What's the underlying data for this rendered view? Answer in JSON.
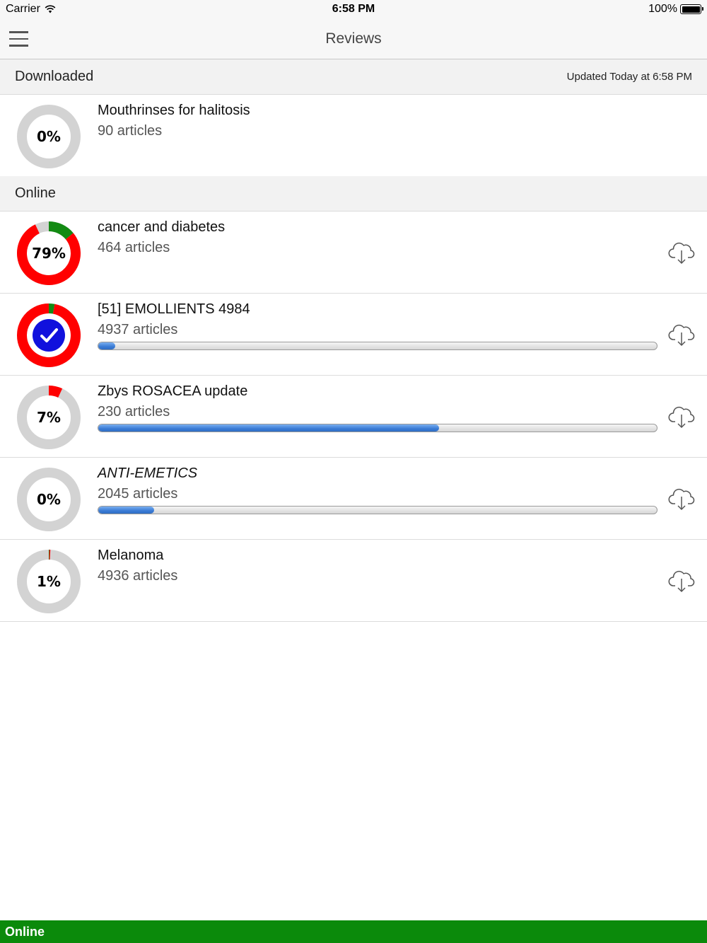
{
  "status_bar": {
    "carrier": "Carrier",
    "time": "6:58 PM",
    "battery": "100%"
  },
  "nav": {
    "title": "Reviews",
    "menu_icon": "hamburger-menu-icon"
  },
  "downloaded": {
    "title": "Downloaded",
    "updated": "Updated Today at 6:58 PM",
    "items": [
      {
        "title": "Mouthrinses for halitosis",
        "subtitle": "90 articles",
        "percent": "0%",
        "ring": {
          "red": 0,
          "green": 0
        }
      }
    ]
  },
  "online": {
    "title": "Online",
    "items": [
      {
        "title": "cancer and diabetes",
        "subtitle": "464 articles",
        "percent": "79%",
        "ring": {
          "red": 0.79,
          "green": 0.14
        },
        "progress": null,
        "icon": "cloud-download-icon"
      },
      {
        "title": "[51] EMOLLIENTS 4984",
        "subtitle": "4937 articles",
        "percent": "",
        "ring": {
          "red": 0.97,
          "green": 0.03
        },
        "checked": true,
        "progress": 0.03,
        "icon": "cloud-download-icon"
      },
      {
        "title": "Zbys ROSACEA update",
        "subtitle": "230 articles",
        "percent": "7%",
        "ring": {
          "red": 0.07,
          "green": 0
        },
        "progress": 0.61,
        "icon": "cloud-download-icon"
      },
      {
        "title": "ANTI-EMETICS",
        "subtitle": "2045 articles",
        "percent": "0%",
        "ring": {
          "red": 0,
          "green": 0
        },
        "progress": 0.1,
        "italic": true,
        "icon": "cloud-download-icon"
      },
      {
        "title": "Melanoma",
        "subtitle": "4936 articles",
        "percent": "1%",
        "ring": {
          "red": 0.005,
          "green": 0.003
        },
        "progress": null,
        "icon": "cloud-download-icon"
      }
    ]
  },
  "colors": {
    "ring_base": "#d3d3d3",
    "ring_red": "#ff0000",
    "ring_green": "#138a13",
    "check_blue": "#1111dd",
    "footer_green": "#0b8a0b"
  },
  "footer": {
    "status": "Online"
  }
}
